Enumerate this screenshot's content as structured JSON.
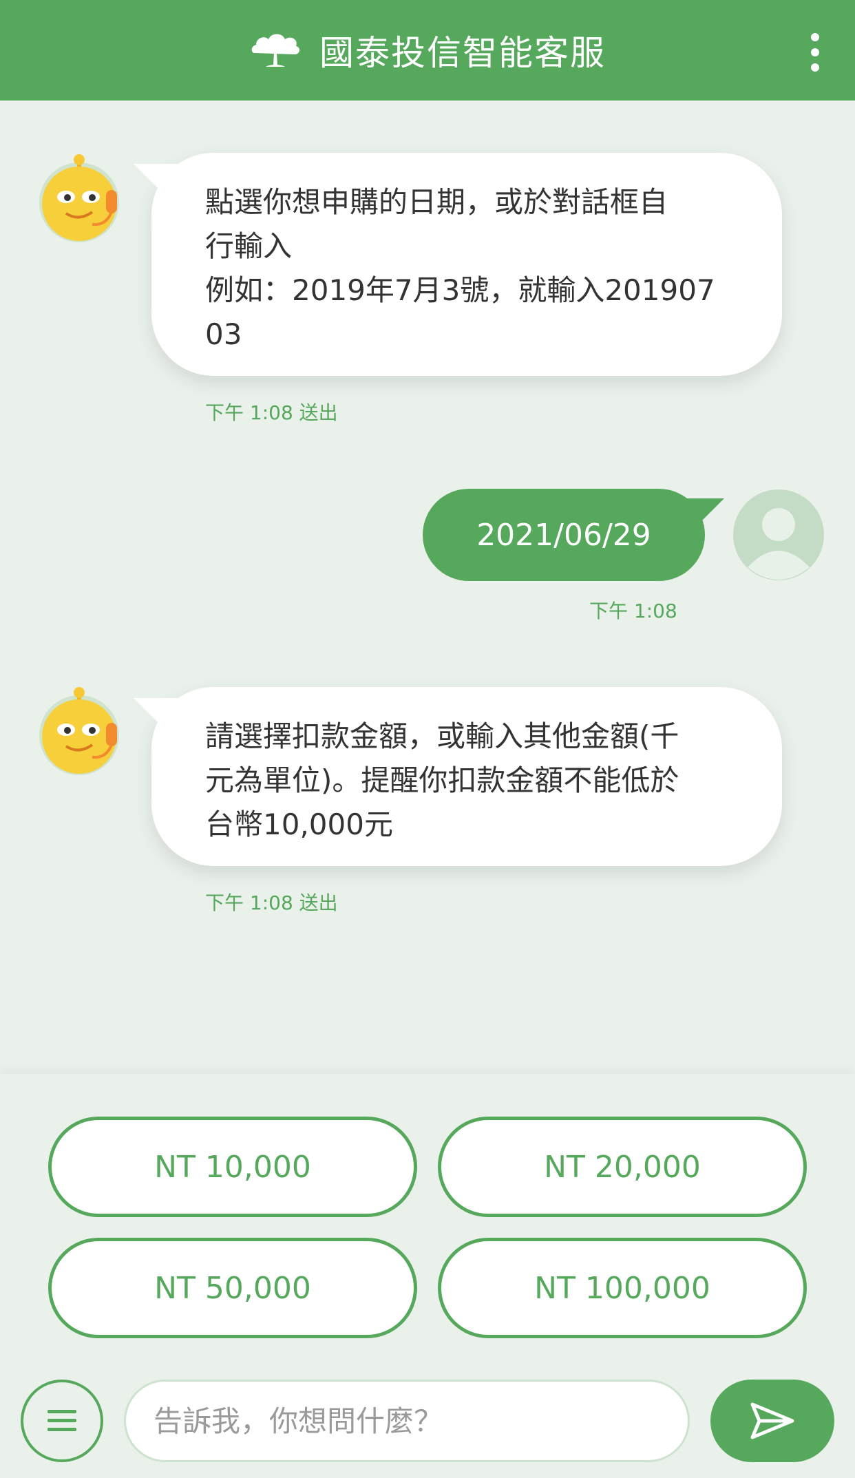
{
  "header": {
    "title": "國泰投信智能客服",
    "logo_icon": "tree-logo-icon",
    "menu_icon": "more-vertical-icon"
  },
  "colors": {
    "brand_green": "#56a85c",
    "chat_background": "#eaf0ea",
    "bubble_white": "#ffffff"
  },
  "messages": [
    {
      "sender": "bot",
      "lines": [
        "點選你想申購的日期，或於對話框自",
        "行輸入",
        "例如：2019年7月3號，就輸入201907",
        "03"
      ],
      "time": "下午 1:08 送出"
    },
    {
      "sender": "user",
      "text": "2021/06/29",
      "time": "下午 1:08"
    },
    {
      "sender": "bot",
      "lines": [
        "請選擇扣款金額，或輸入其他金額(千",
        "元為單位)。提醒你扣款金額不能低於",
        "台幣10,000元"
      ],
      "time": "下午 1:08 送出"
    }
  ],
  "quick_replies": [
    "NT 10,000",
    "NT 20,000",
    "NT 50,000",
    "NT 100,000"
  ],
  "composer": {
    "placeholder": "告訴我，你想問什麼？",
    "value": "",
    "menu_icon": "hamburger-menu-icon",
    "send_icon": "send-icon"
  }
}
